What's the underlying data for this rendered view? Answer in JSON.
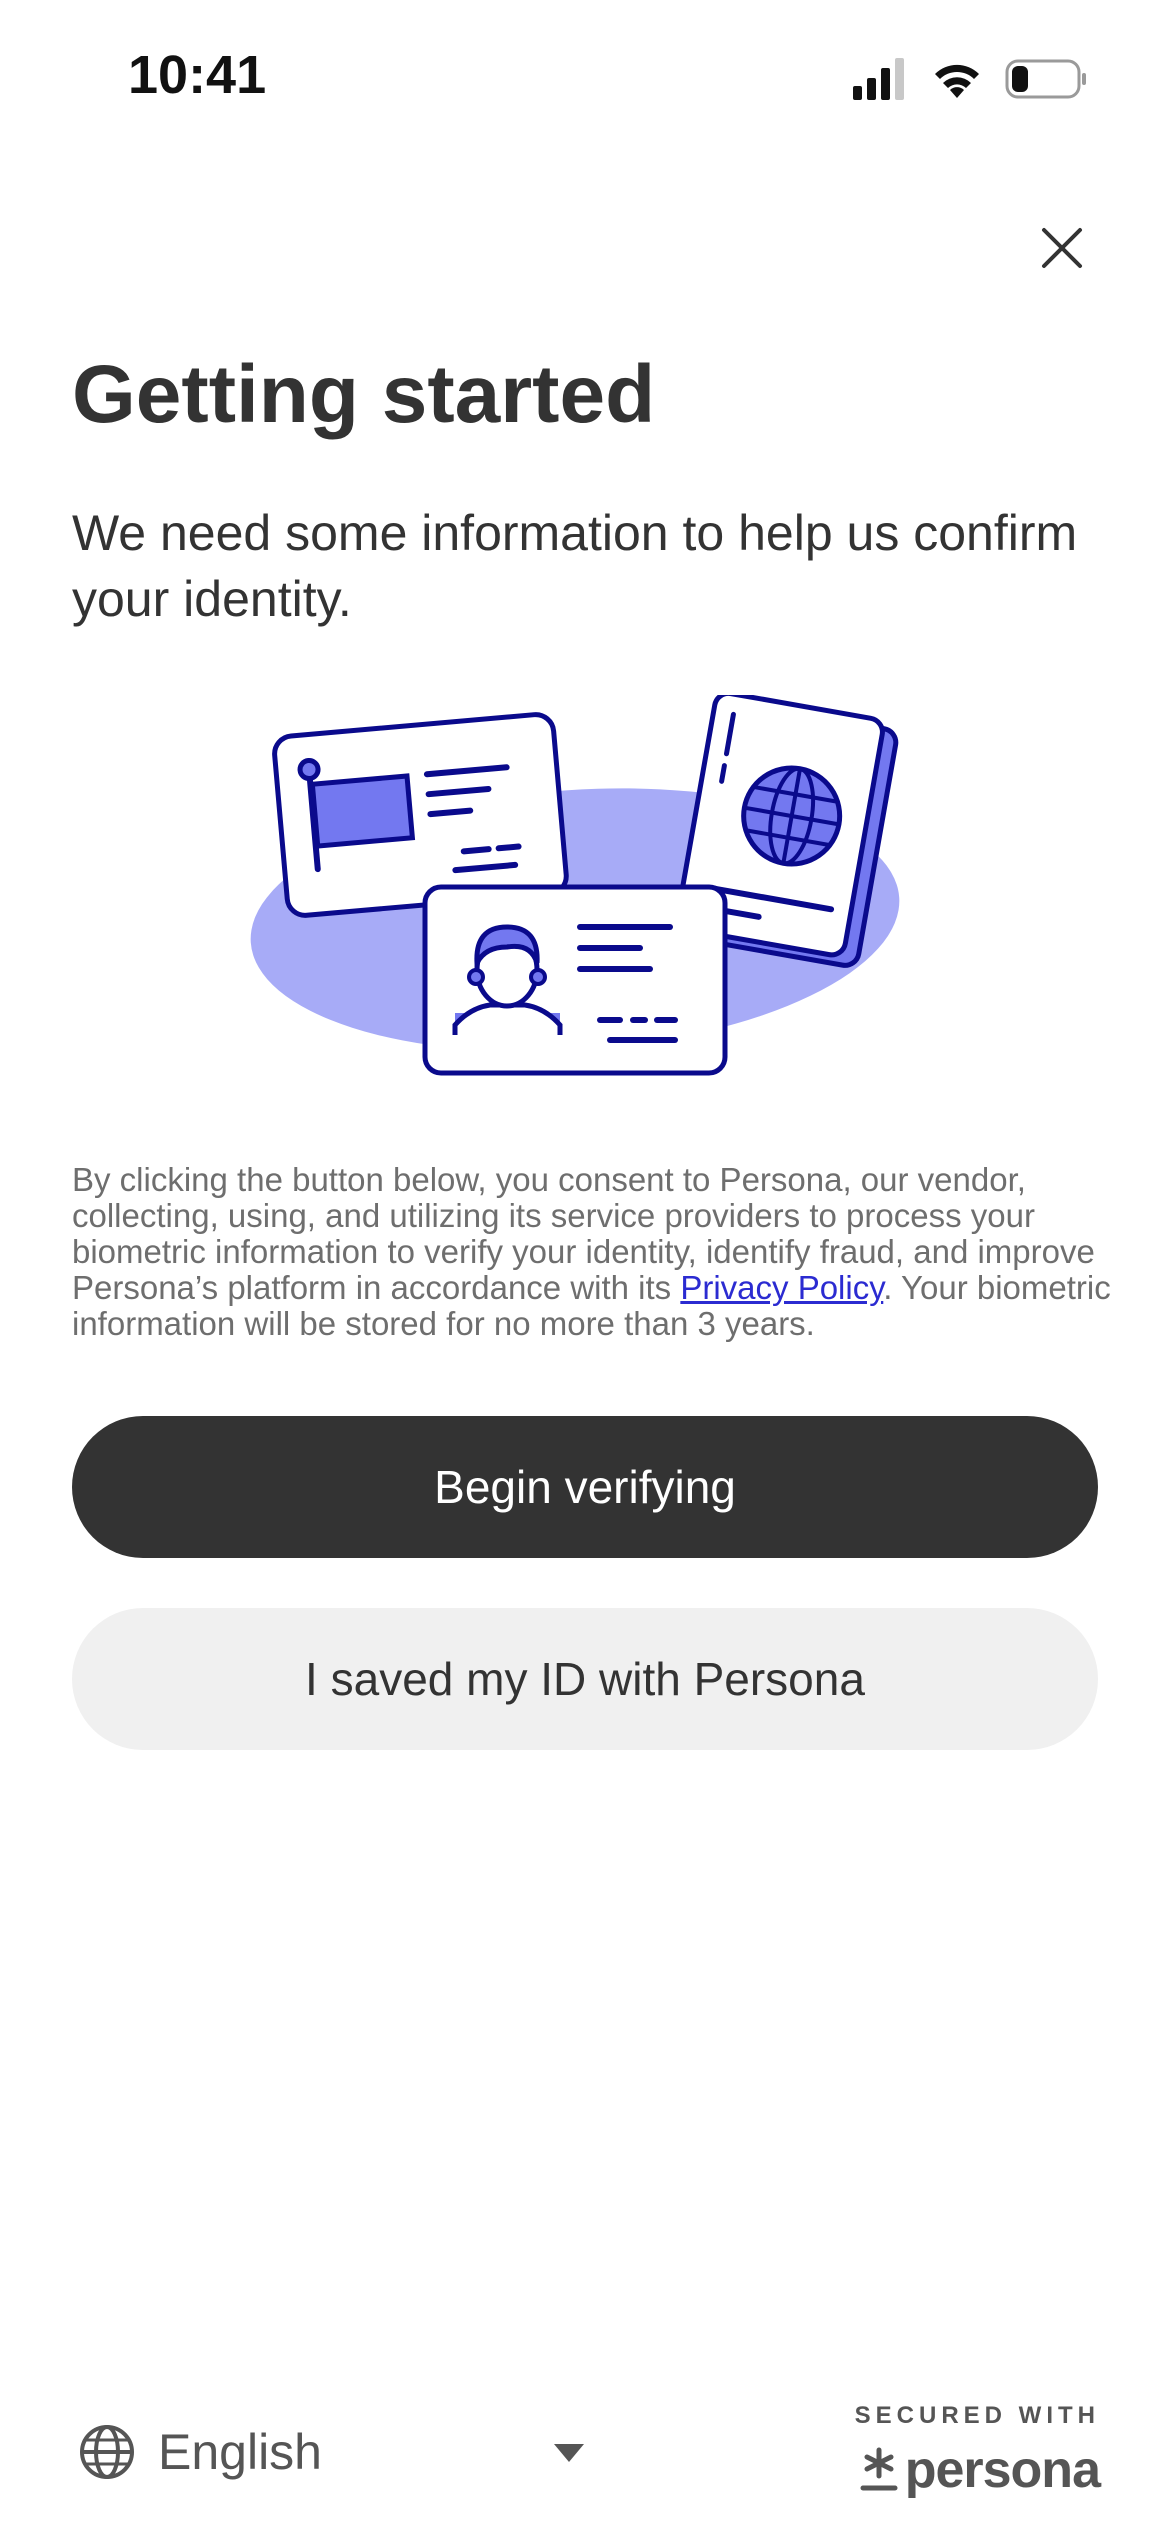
{
  "status_bar": {
    "time": "10:41",
    "battery_level": 0.25
  },
  "title": "Getting started",
  "subtitle": "We need some information to help us confirm your identity.",
  "consent": {
    "text_before_link": "By clicking the button below, you consent to Persona, our vendor, collecting, using, and utilizing its service providers to process your biometric information to verify your identity, identify fraud, and improve Persona’s platform in accordance with its ",
    "link_text": "Privacy Policy",
    "text_after_link": ". Your biometric information will be stored for no more than 3 years."
  },
  "buttons": {
    "primary_label": "Begin verifying",
    "secondary_label": "I saved my ID with Persona"
  },
  "footer": {
    "language": "English",
    "secured_label": "SECURED WITH",
    "brand_name": "persona"
  },
  "colors": {
    "primary_button": "#333333",
    "secondary_button": "#f0f0f0",
    "illustration_stroke": "#0a0a8c",
    "illustration_fill": "#a7abf7",
    "illustration_accent": "#7378f0",
    "link": "#2b2bd1"
  },
  "icons": [
    "signal-icon",
    "wifi-icon",
    "battery-icon",
    "close-icon",
    "globe-icon",
    "caret-down-icon",
    "persona-asterisk-icon"
  ]
}
